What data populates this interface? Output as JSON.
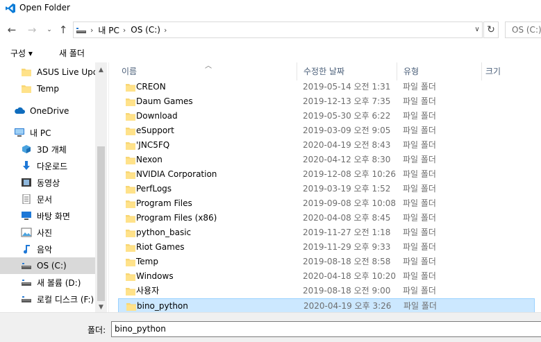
{
  "window": {
    "title": "Open Folder"
  },
  "address": {
    "crumbs": [
      "내 PC",
      "OS (C:)"
    ],
    "search_placeholder": "OS (C:)"
  },
  "commands": {
    "organize": "구성 ▾",
    "new_folder": "새 폴더"
  },
  "nav": {
    "items": [
      {
        "label": "ASUS Live Upda",
        "icon": "folder-icon",
        "selected": false
      },
      {
        "label": "Temp",
        "icon": "folder-icon",
        "selected": false
      },
      {
        "label": "OneDrive",
        "icon": "cloud-icon",
        "selected": false
      },
      {
        "label": "내 PC",
        "icon": "computer-icon",
        "selected": false
      },
      {
        "label": "3D 개체",
        "icon": "cube-icon",
        "selected": false
      },
      {
        "label": "다운로드",
        "icon": "download-icon",
        "selected": false
      },
      {
        "label": "동영상",
        "icon": "video-icon",
        "selected": false
      },
      {
        "label": "문서",
        "icon": "document-icon",
        "selected": false
      },
      {
        "label": "바탕 화면",
        "icon": "desktop-icon",
        "selected": false
      },
      {
        "label": "사진",
        "icon": "picture-icon",
        "selected": false
      },
      {
        "label": "음악",
        "icon": "music-icon",
        "selected": false
      },
      {
        "label": "OS (C:)",
        "icon": "drive-icon",
        "selected": true
      },
      {
        "label": "새 볼륨 (D:)",
        "icon": "drive-icon",
        "selected": false
      },
      {
        "label": "로컬 디스크 (F:)",
        "icon": "drive-icon",
        "selected": false
      }
    ]
  },
  "columns": {
    "name": "이름",
    "date": "수정한 날짜",
    "type": "유형",
    "size": "크기"
  },
  "files": [
    {
      "name": "CREON",
      "date": "2019-05-14 오전 1:31",
      "type": "파일 폴더"
    },
    {
      "name": "Daum Games",
      "date": "2019-12-13 오후 7:35",
      "type": "파일 폴더"
    },
    {
      "name": "Download",
      "date": "2019-05-30 오후 6:22",
      "type": "파일 폴더"
    },
    {
      "name": "eSupport",
      "date": "2019-03-09 오전 9:05",
      "type": "파일 폴더"
    },
    {
      "name": "'JNC5FQ",
      "date": "2020-04-19 오전 8:43",
      "type": "파일 폴더"
    },
    {
      "name": "Nexon",
      "date": "2020-04-12 오후 8:30",
      "type": "파일 폴더"
    },
    {
      "name": "NVIDIA Corporation",
      "date": "2019-12-08 오후 10:26",
      "type": "파일 폴더"
    },
    {
      "name": "PerfLogs",
      "date": "2019-03-19 오후 1:52",
      "type": "파일 폴더"
    },
    {
      "name": "Program Files",
      "date": "2019-09-08 오후 10:08",
      "type": "파일 폴더"
    },
    {
      "name": "Program Files (x86)",
      "date": "2020-04-08 오후 8:45",
      "type": "파일 폴더"
    },
    {
      "name": "python_basic",
      "date": "2019-11-27 오전 1:18",
      "type": "파일 폴더"
    },
    {
      "name": "Riot Games",
      "date": "2019-11-29 오후 9:33",
      "type": "파일 폴더"
    },
    {
      "name": "Temp",
      "date": "2019-08-18 오전 8:58",
      "type": "파일 폴더"
    },
    {
      "name": "Windows",
      "date": "2020-04-18 오후 10:20",
      "type": "파일 폴더"
    },
    {
      "name": "사용자",
      "date": "2019-08-18 오전 9:00",
      "type": "파일 폴더"
    },
    {
      "name": "bino_python",
      "date": "2020-04-19 오후 3:26",
      "type": "파일 폴더",
      "selected": true
    }
  ],
  "bottom": {
    "folder_label": "폴더:",
    "folder_value": "bino_python"
  },
  "colors": {
    "accent": "#0078d7",
    "selection": "#cce8ff",
    "folder": "#f8d775"
  }
}
